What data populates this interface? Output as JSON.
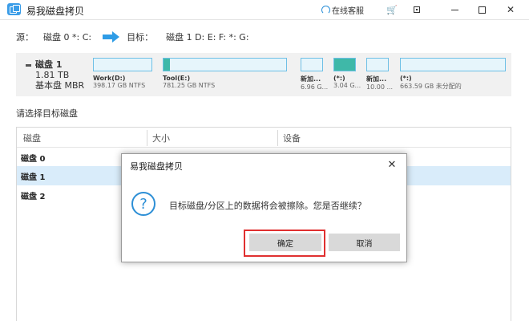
{
  "window": {
    "title": "易我磁盘拷贝",
    "service_label": "在线客服",
    "colors": {
      "accent": "#2e9ce6",
      "selected_row": "#d9ecfa",
      "highlight": "#e03030"
    }
  },
  "copy_path": {
    "source_label": "源：",
    "source_value": "磁盘 0 *: C:",
    "target_label": "目标：",
    "target_value": "磁盘 1 D: E: F: *: G:"
  },
  "disk_map": {
    "disk_name": "磁盘 1",
    "disk_size": "1.81 TB",
    "disk_type": "基本盘 MBR",
    "partitions": [
      {
        "label": "Work(D:)",
        "sub": "398.17 GB NTFS",
        "used": 0
      },
      {
        "label": "Tool(E:)",
        "sub": "781.25 GB NTFS",
        "used": 0.05
      },
      {
        "label": "新加...",
        "sub": "6.96 G...",
        "used": 0
      },
      {
        "label": "(*:)",
        "sub": "3.04 G...",
        "used": 1
      },
      {
        "label": "新加...",
        "sub": "10.00 ...",
        "used": 0
      },
      {
        "label": "(*:)",
        "sub": "663.59 GB 未分配的",
        "used": 0
      }
    ]
  },
  "section_label": "请选择目标磁盘",
  "table": {
    "columns": [
      "磁盘",
      "大小",
      "设备"
    ],
    "rows": [
      "磁盘 0",
      "磁盘 1",
      "磁盘 2"
    ]
  },
  "dialog": {
    "title": "易我磁盘拷贝",
    "message": "目标磁盘/分区上的数据将会被擦除。您是否继续？",
    "ok_label": "确定",
    "cancel_label": "取消"
  }
}
